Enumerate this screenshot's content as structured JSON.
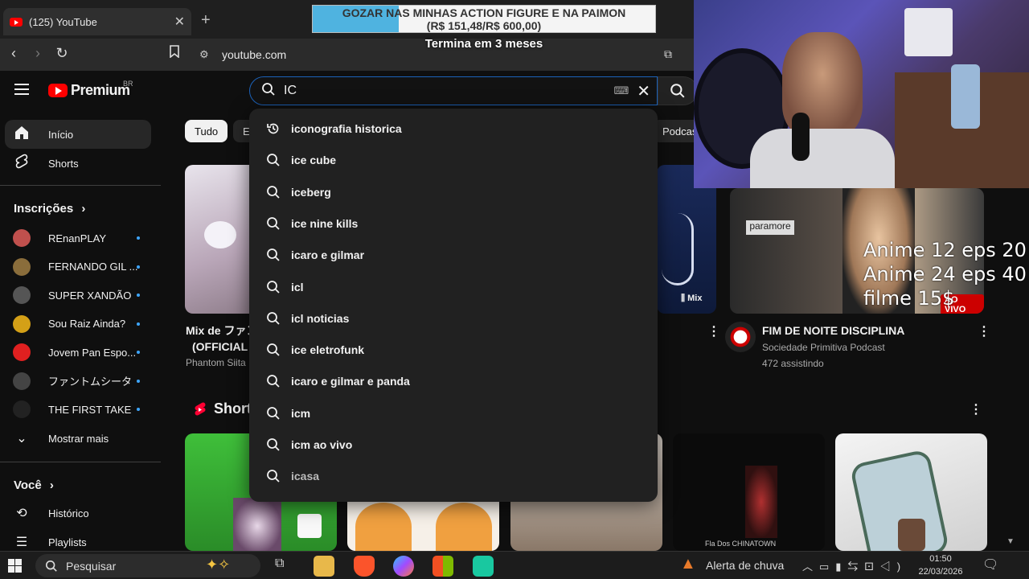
{
  "browser": {
    "tab_title": "(125) YouTube",
    "url": "youtube.com"
  },
  "stream_overlay": {
    "goal_line1": "GOZAR NAS MINHAS ACTION FIGURE E NA PAIMON",
    "goal_line2": "(R$ 151,48/R$ 600,00)",
    "goal_progress": 0.25,
    "goal_deadline": "Termina em 3 meses",
    "price_lines": [
      "Anime 12 eps 20",
      "Anime 24 eps 40",
      "filme 15$"
    ]
  },
  "youtube": {
    "logo_text": "Premium",
    "logo_region": "BR",
    "search_value": "IC",
    "chips": [
      "Tudo",
      "E",
      "Podcas"
    ],
    "suggestions": [
      {
        "text": "iconografia historica",
        "type": "history"
      },
      {
        "text": "ice cube",
        "type": "search"
      },
      {
        "text": "iceberg",
        "type": "search"
      },
      {
        "text": "ice nine kills",
        "type": "search"
      },
      {
        "text": "icaro e gilmar",
        "type": "search"
      },
      {
        "text": "icl",
        "type": "search"
      },
      {
        "text": "icl noticias",
        "type": "search"
      },
      {
        "text": "ice eletrofunk",
        "type": "search"
      },
      {
        "text": "icaro e gilmar e panda",
        "type": "search"
      },
      {
        "text": "icm",
        "type": "search"
      },
      {
        "text": "icm ao vivo",
        "type": "search"
      },
      {
        "text": "icasa",
        "type": "search"
      }
    ],
    "sidebar": {
      "home": "Início",
      "shorts": "Shorts",
      "subscriptions_heading": "Inscrições",
      "subscriptions": [
        {
          "name": "REnanPLAY",
          "color": "#c0504d"
        },
        {
          "name": "FERNANDO GIL ...",
          "color": "#8a6d3b"
        },
        {
          "name": "SUPER XANDÃO",
          "color": "#555555"
        },
        {
          "name": "Sou Raiz Ainda?",
          "color": "#d4a017"
        },
        {
          "name": "Jovem Pan Espo...",
          "color": "#e02020"
        },
        {
          "name": "ファントムシータ",
          "color": "#444444"
        },
        {
          "name": "THE FIRST TAKE",
          "color": "#222222"
        }
      ],
      "show_more": "Mostrar mais",
      "you_heading": "Você",
      "history": "Histórico",
      "playlists": "Playlists"
    },
    "videos": {
      "left_title_line1": "Mix de ファン",
      "left_title_line2": "(OFFICIAL",
      "left_channel": "Phantom Siita",
      "mix_badge": "Mix",
      "live_badge": "AO VIVO",
      "live_title": "FIM DE NOITE DISCIPLINA",
      "live_channel": "Sociedade Primitiva Podcast",
      "live_viewers": "472 assistindo",
      "live_thumb_text": "paramore",
      "shorts_heading": "Short",
      "short_caption": "Fla Dos CHINATOWN"
    }
  },
  "taskbar": {
    "search_placeholder": "Pesquisar",
    "weather": "Alerta de chuva",
    "time": "01:50",
    "date": "22/03/2026"
  }
}
